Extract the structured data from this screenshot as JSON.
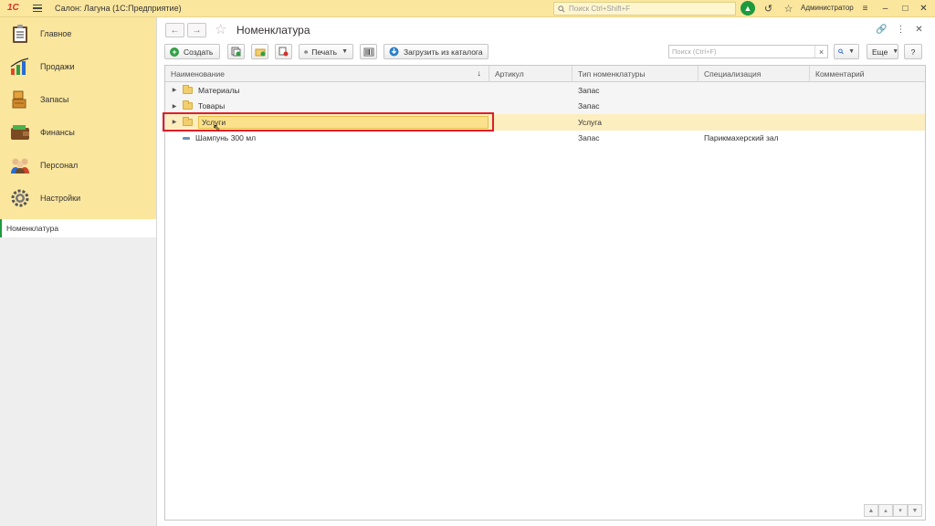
{
  "app": {
    "title": "Салон: Лагуна  (1С:Предприятие)",
    "logo": "1С"
  },
  "topbar": {
    "search_placeholder": "Поиск Ctrl+Shift+F",
    "user": "Администратор"
  },
  "sidebar": {
    "sections": [
      {
        "label": "Главное",
        "icon": "clipboard-icon"
      },
      {
        "label": "Продажи",
        "icon": "sales-chart-icon"
      },
      {
        "label": "Запасы",
        "icon": "boxes-icon"
      },
      {
        "label": "Финансы",
        "icon": "wallet-icon"
      },
      {
        "label": "Персонал",
        "icon": "people-icon"
      },
      {
        "label": "Настройки",
        "icon": "gear-icon"
      }
    ],
    "open_windows": [
      {
        "label": "Номенклатура"
      }
    ]
  },
  "form": {
    "title": "Номенклатура",
    "commands": {
      "create": "Создать",
      "print": "Печать",
      "load": "Загрузить из каталога",
      "more": "Еще",
      "help": "?",
      "search_placeholder": "Поиск (Ctrl+F)"
    },
    "table": {
      "columns": [
        "Наименование",
        "Артикул",
        "Тип номенклатуры",
        "Специализация",
        "Комментарий"
      ],
      "rows": [
        {
          "name": "Материалы",
          "article": "",
          "type": "Запас",
          "spec": "",
          "comment": "",
          "kind": "group"
        },
        {
          "name": "Товары",
          "article": "",
          "type": "Запас",
          "spec": "",
          "comment": "",
          "kind": "group"
        },
        {
          "name": "Услуги",
          "article": "",
          "type": "Услуга",
          "spec": "",
          "comment": "",
          "kind": "group-selected"
        },
        {
          "name": "Шампунь 300 мл",
          "article": "",
          "type": "Запас",
          "spec": "Парикмахерский зал",
          "comment": "",
          "kind": "item"
        }
      ]
    }
  },
  "colors": {
    "accent": "#fbe69e",
    "highlight_frame": "#e01e2a",
    "selected_row": "#fdeec0",
    "status_green": "#1e9a3d"
  }
}
